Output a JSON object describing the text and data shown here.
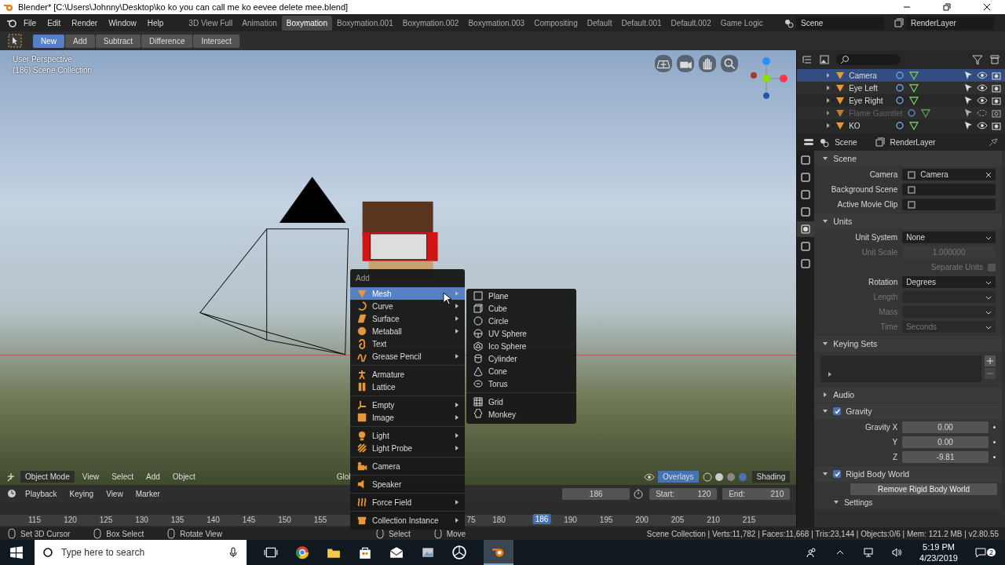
{
  "window": {
    "title": "Blender* [C:\\Users\\Johnny\\Desktop\\ko ko you can call me ko eevee delete mee.blend]"
  },
  "menu_bar": [
    "File",
    "Edit",
    "Render",
    "Window",
    "Help"
  ],
  "workspace_tabs": [
    {
      "label": "3D View Full",
      "selected": false
    },
    {
      "label": "Animation",
      "selected": false
    },
    {
      "label": "Boxymation",
      "selected": true
    },
    {
      "label": "Boxymation.001",
      "selected": false
    },
    {
      "label": "Boxymation.002",
      "selected": false
    },
    {
      "label": "Boxymation.003",
      "selected": false
    },
    {
      "label": "Compositing",
      "selected": false
    },
    {
      "label": "Default",
      "selected": false
    },
    {
      "label": "Default.001",
      "selected": false
    },
    {
      "label": "Default.002",
      "selected": false
    },
    {
      "label": "Game Logic",
      "selected": false
    }
  ],
  "scene_field": "Scene",
  "render_layer_field": "RenderLayer",
  "tool_header": [
    {
      "label": "New",
      "selected": true
    },
    {
      "label": "Add",
      "selected": false
    },
    {
      "label": "Subtract",
      "selected": false
    },
    {
      "label": "Difference",
      "selected": false
    },
    {
      "label": "Intersect",
      "selected": false
    }
  ],
  "viewport": {
    "view_name": "User Perspective",
    "collection": "(186) Scene Collection",
    "mode": "Object Mode",
    "menus": [
      "View",
      "Select",
      "Add",
      "Object"
    ],
    "orientation": "Glob",
    "overlays": "Overlays",
    "shading": "Shading"
  },
  "add_menu": {
    "title": "Add",
    "groups": [
      [
        {
          "label": "Mesh",
          "submenu": true,
          "selected": true
        },
        {
          "label": "Curve",
          "submenu": true,
          "selected": false
        },
        {
          "label": "Surface",
          "submenu": true,
          "selected": false
        },
        {
          "label": "Metaball",
          "submenu": true,
          "selected": false
        },
        {
          "label": "Text",
          "submenu": false,
          "selected": false
        },
        {
          "label": "Grease Pencil",
          "submenu": true,
          "selected": false
        }
      ],
      [
        {
          "label": "Armature",
          "submenu": false,
          "selected": false
        },
        {
          "label": "Lattice",
          "submenu": false,
          "selected": false
        }
      ],
      [
        {
          "label": "Empty",
          "submenu": true,
          "selected": false
        },
        {
          "label": "Image",
          "submenu": true,
          "selected": false
        }
      ],
      [
        {
          "label": "Light",
          "submenu": true,
          "selected": false
        },
        {
          "label": "Light Probe",
          "submenu": true,
          "selected": false
        }
      ],
      [
        {
          "label": "Camera",
          "submenu": false,
          "selected": false
        }
      ],
      [
        {
          "label": "Speaker",
          "submenu": false,
          "selected": false
        }
      ],
      [
        {
          "label": "Force Field",
          "submenu": true,
          "selected": false
        }
      ],
      [
        {
          "label": "Collection Instance",
          "submenu": true,
          "selected": false
        }
      ]
    ]
  },
  "mesh_submenu": [
    [
      "Plane",
      "Cube",
      "Circle",
      "UV Sphere",
      "Ico Sphere",
      "Cylinder",
      "Cone",
      "Torus"
    ],
    [
      "Grid",
      "Monkey"
    ]
  ],
  "timeline": {
    "menus": [
      "Playback",
      "Keying",
      "View",
      "Marker"
    ],
    "current_frame": "186",
    "start_label": "Start:",
    "start_value": "120",
    "end_label": "End:",
    "end_value": "210",
    "ticks": [
      "115",
      "120",
      "125",
      "130",
      "135",
      "140",
      "145",
      "150",
      "155",
      "180",
      "190",
      "195",
      "200",
      "205",
      "210",
      "215"
    ],
    "playhead": "186",
    "partial_tick": "75"
  },
  "outliner": [
    {
      "name": "Camera",
      "selected": true,
      "disabled": false
    },
    {
      "name": "Eye Left",
      "selected": false,
      "disabled": false
    },
    {
      "name": "Eye Right",
      "selected": false,
      "disabled": false
    },
    {
      "name": "Flame Gauntlet",
      "selected": false,
      "disabled": true
    },
    {
      "name": "KO",
      "selected": false,
      "disabled": false
    }
  ],
  "properties": {
    "scene": "Scene",
    "layer": "RenderLayer",
    "tabs": [
      {
        "selected": false
      },
      {
        "selected": false
      },
      {
        "selected": false
      },
      {
        "selected": false
      },
      {
        "selected": true
      },
      {
        "selected": false
      },
      {
        "selected": false
      }
    ],
    "sections": [
      {
        "title": "Scene",
        "expanded": true,
        "rows": [
          {
            "kind": "object",
            "label": "Camera",
            "value": "Camera"
          },
          {
            "kind": "object",
            "label": "Background Scene"
          },
          {
            "kind": "object",
            "label": "Active Movie Clip"
          }
        ]
      },
      {
        "title": "Units",
        "expanded": true,
        "rows": [
          {
            "kind": "dropdown",
            "label": "Unit System",
            "value": "None",
            "disabled": false
          },
          {
            "kind": "number",
            "label": "Unit Scale",
            "value": "1.000000",
            "disabled": true
          },
          {
            "kind": "checkbox",
            "label": "Separate Units",
            "checked": false,
            "disabled": true
          },
          {
            "kind": "dropdown",
            "label": "Rotation",
            "value": "Degrees",
            "disabled": false
          },
          {
            "kind": "dropdown",
            "label": "Length",
            "disabled": true
          },
          {
            "kind": "dropdown",
            "label": "Mass",
            "disabled": true
          },
          {
            "kind": "dropdown",
            "label": "Time",
            "value": "Seconds",
            "disabled": true
          }
        ]
      },
      {
        "title": "Keying Sets",
        "expanded": true,
        "rows": [
          {
            "kind": "list"
          }
        ]
      },
      {
        "title": "Audio",
        "expanded": false
      },
      {
        "title": "Gravity",
        "expanded": true,
        "checked": true,
        "rows": [
          {
            "kind": "number",
            "label": "Gravity X",
            "value": "0.00"
          },
          {
            "kind": "number",
            "label": "Y",
            "value": "0.00"
          },
          {
            "kind": "number",
            "label": "Z",
            "value": "-9.81"
          }
        ]
      },
      {
        "title": "Rigid Body World",
        "expanded": true,
        "checked": true,
        "rows": [
          {
            "kind": "button",
            "label": "Remove Rigid Body World"
          },
          {
            "kind": "subsection",
            "label": "Settings"
          }
        ]
      }
    ]
  },
  "status_bar": {
    "hints": [
      "Set 3D Cursor",
      "Box Select",
      "Rotate View",
      "Select",
      "Move"
    ],
    "stats": "Scene Collection | Verts:11,782 | Faces:11,668 | Tris:23,144 | Objects:0/6 | Mem: 121.2 MB | v2.80.55"
  },
  "taskbar": {
    "search_placeholder": "Type here to search",
    "time": "5:19 PM",
    "date": "4/23/2019",
    "notifications": "2"
  }
}
